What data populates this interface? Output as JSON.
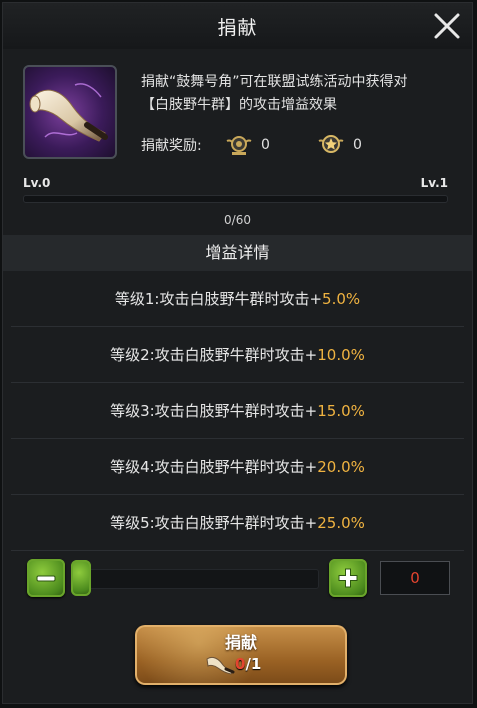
{
  "dialog": {
    "title": "捐献"
  },
  "item": {
    "icon": "war-horn-icon",
    "description_line1": "捐献“鼓舞号角”可在联盟试练活动中获得对",
    "description_line2": "【白肢野牛群】的攻击增益效果"
  },
  "reward": {
    "label": "捐献奖励:",
    "items": [
      {
        "icon": "alliance-medal-icon",
        "value": "0"
      },
      {
        "icon": "star-medal-icon",
        "value": "0"
      }
    ]
  },
  "level": {
    "current_label": "Lv.0",
    "next_label": "Lv.1",
    "progress_text": "0/60",
    "progress_fraction": 0
  },
  "bonus": {
    "header": "增益详情",
    "rows": [
      {
        "text": "等级1:攻击白肢野牛群时攻击+",
        "value": "5.0%"
      },
      {
        "text": "等级2:攻击白肢野牛群时攻击+",
        "value": "10.0%"
      },
      {
        "text": "等级3:攻击白肢野牛群时攻击+",
        "value": "15.0%"
      },
      {
        "text": "等级4:攻击白肢野牛群时攻击+",
        "value": "20.0%"
      },
      {
        "text": "等级5:攻击白肢野牛群时攻击+",
        "value": "25.0%"
      }
    ]
  },
  "quantity": {
    "value": "0",
    "slider_fraction": 0
  },
  "donate_button": {
    "label": "捐献",
    "cost_have": "0",
    "cost_sep": "/",
    "cost_need": "1",
    "cost_icon": "horn-icon"
  },
  "colors": {
    "accent_value": "#f0b341",
    "warning_red": "#e4442f",
    "control_green": "#5fa323"
  }
}
